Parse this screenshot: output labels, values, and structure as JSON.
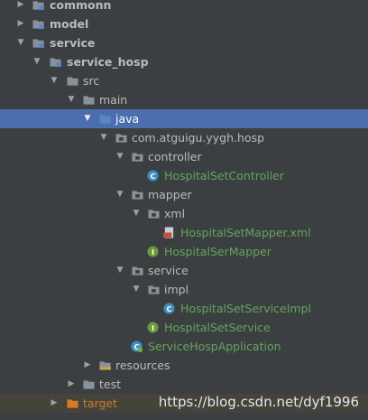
{
  "tree": {
    "commonn": "commonn",
    "model": "model",
    "service": "service",
    "service_hosp": "service_hosp",
    "src": "src",
    "main": "main",
    "java": "java",
    "package": "com.atguigu.yygh.hosp",
    "controller": "controller",
    "hospital_set_controller": "HospitalSetController",
    "mapper": "mapper",
    "xml": "xml",
    "hospital_set_mapper_xml": "HospitalSetMapper.xml",
    "hospital_ser_mapper": "HospitalSerMapper",
    "service_pkg": "service",
    "impl": "impl",
    "hospital_set_service_impl": "HospitalSetServiceImpl",
    "hospital_set_service": "HospitalSetService",
    "service_hosp_application": "ServiceHospApplication",
    "resources": "resources",
    "test": "test",
    "target": "target"
  },
  "watermark": "https://blog.csdn.net/dyf1996",
  "colors": {
    "background": "#3c3f41",
    "selection": "#4b6eaf",
    "class_text": "#62a55c",
    "excluded_text": "#c87d2e"
  }
}
